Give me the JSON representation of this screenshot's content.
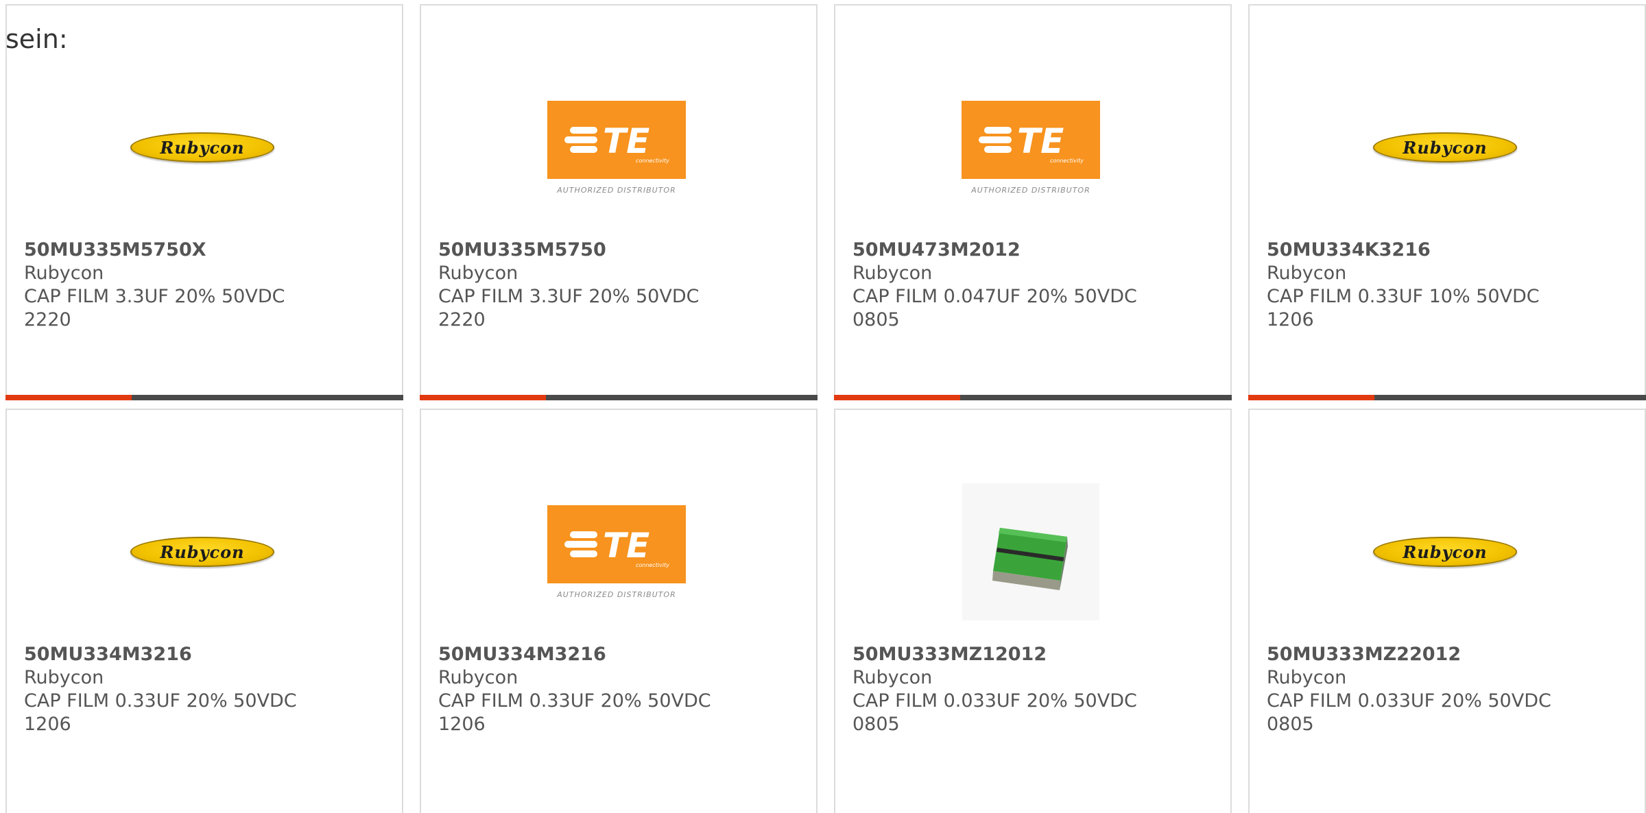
{
  "intro_text": "sein:",
  "brand_colors": {
    "accent": "#e23a10",
    "bar": "#4a4a4a",
    "te_orange": "#f7931e",
    "rubycon_yellow": "#f2c200"
  },
  "products": [
    {
      "part_number": "50MU335M5750X",
      "manufacturer": "Rubycon",
      "description": "CAP FILM 3.3UF 20% 50VDC",
      "package": "2220",
      "image": "rubycon-logo"
    },
    {
      "part_number": "50MU335M5750",
      "manufacturer": "Rubycon",
      "description": "CAP FILM 3.3UF 20% 50VDC",
      "package": "2220",
      "image": "te-connectivity-logo"
    },
    {
      "part_number": "50MU473M2012",
      "manufacturer": "Rubycon",
      "description": "CAP FILM 0.047UF 20% 50VDC",
      "package": "0805",
      "image": "te-connectivity-logo"
    },
    {
      "part_number": "50MU334K3216",
      "manufacturer": "Rubycon",
      "description": "CAP FILM 0.33UF 10% 50VDC",
      "package": "1206",
      "image": "rubycon-logo"
    },
    {
      "part_number": "50MU334M3216",
      "manufacturer": "Rubycon",
      "description": "CAP FILM 0.33UF 20% 50VDC",
      "package": "1206",
      "image": "rubycon-logo"
    },
    {
      "part_number": "50MU334M3216",
      "manufacturer": "Rubycon",
      "description": "CAP FILM 0.33UF 20% 50VDC",
      "package": "1206",
      "image": "te-connectivity-logo"
    },
    {
      "part_number": "50MU333MZ12012",
      "manufacturer": "Rubycon",
      "description": "CAP FILM 0.033UF 20% 50VDC",
      "package": "0805",
      "image": "capacitor-chip-photo"
    },
    {
      "part_number": "50MU333MZ22012",
      "manufacturer": "Rubycon",
      "description": "CAP FILM 0.033UF 20% 50VDC",
      "package": "0805",
      "image": "rubycon-logo"
    }
  ],
  "logos": {
    "rubycon_text": "Rubycon",
    "te_text": "TE",
    "te_connectivity": "connectivity",
    "te_sub": "AUTHORIZED DISTRIBUTOR"
  }
}
